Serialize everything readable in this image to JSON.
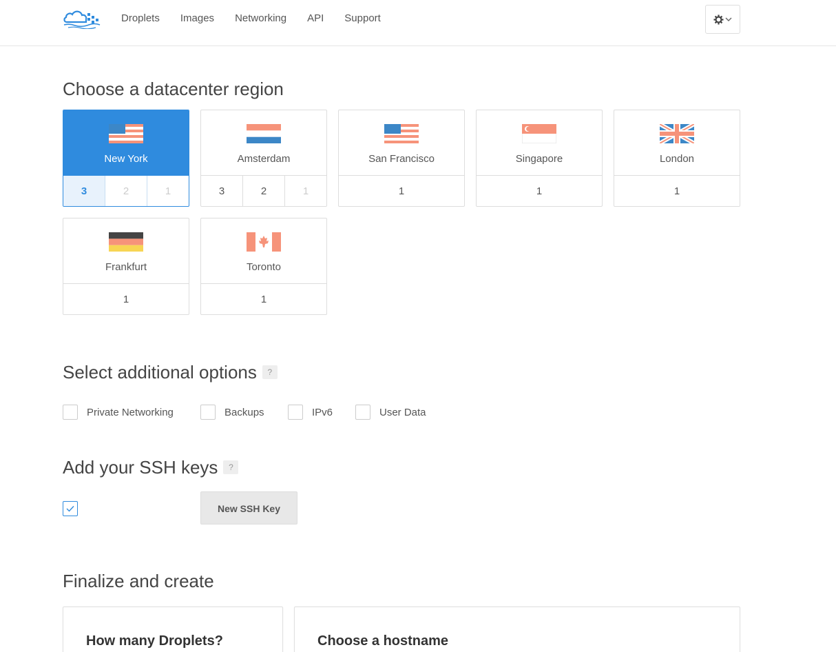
{
  "nav": {
    "items": [
      "Droplets",
      "Images",
      "Networking",
      "API",
      "Support"
    ]
  },
  "colors": {
    "accent": "#2f8bde",
    "flag_orange": "#f6937a",
    "flag_blue": "#3c87c7"
  },
  "region": {
    "heading": "Choose a datacenter region",
    "cards": [
      {
        "name": "New York",
        "flag": "us-flag",
        "dcs": [
          "3",
          "2",
          "1"
        ],
        "selected_dc": "3"
      },
      {
        "name": "Amsterdam",
        "flag": "nl-flag",
        "dcs": [
          "3",
          "2",
          "1"
        ]
      },
      {
        "name": "San Francisco",
        "flag": "us-flag",
        "dcs": [
          "1"
        ]
      },
      {
        "name": "Singapore",
        "flag": "sg-flag",
        "dcs": [
          "1"
        ]
      },
      {
        "name": "London",
        "flag": "uk-flag",
        "dcs": [
          "1"
        ]
      },
      {
        "name": "Frankfurt",
        "flag": "de-flag",
        "dcs": [
          "1"
        ]
      },
      {
        "name": "Toronto",
        "flag": "ca-flag",
        "dcs": [
          "1"
        ]
      }
    ]
  },
  "options": {
    "heading": "Select additional options",
    "help": "?",
    "items": [
      "Private Networking",
      "Backups",
      "IPv6",
      "User Data"
    ]
  },
  "ssh": {
    "heading": "Add your SSH keys",
    "help": "?",
    "new_key_label": "New SSH Key"
  },
  "finalize": {
    "heading": "Finalize and create",
    "count_title": "How many Droplets?",
    "hostname_title": "Choose a hostname"
  }
}
